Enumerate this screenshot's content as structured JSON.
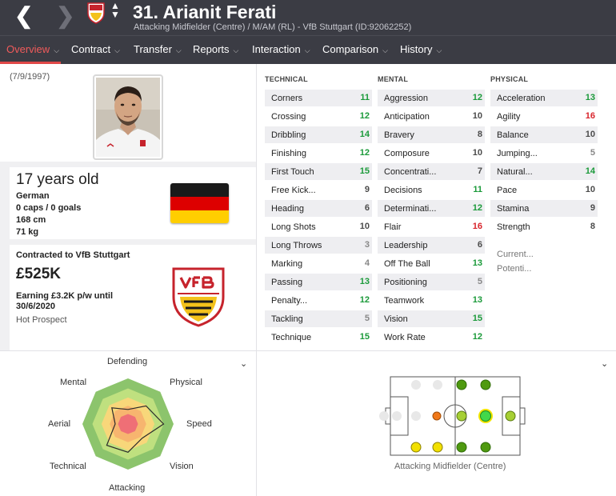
{
  "header": {
    "player_name": "31. Arianit Ferati",
    "player_subtitle": "Attacking Midfielder (Centre) / M/AM (RL) - VfB Stuttgart (ID:92062252)",
    "back_icon": "chevron-left-icon",
    "forward_icon": "chevron-right-icon"
  },
  "tabs": [
    {
      "label": "Overview",
      "active": true
    },
    {
      "label": "Contract"
    },
    {
      "label": "Transfer"
    },
    {
      "label": "Reports"
    },
    {
      "label": "Interaction"
    },
    {
      "label": "Comparison"
    },
    {
      "label": "History"
    }
  ],
  "profile": {
    "dob": "(7/9/1997)",
    "age": "17 years old",
    "nationality": "German",
    "caps": "0 caps / 0 goals",
    "height": "168 cm",
    "weight": "71 kg",
    "contract_title": "Contracted to VfB Stuttgart",
    "value": "£525K",
    "earning": "Earning £3.2K p/w until 30/6/2020",
    "status": "Hot Prospect",
    "flag_colors": [
      "#000000",
      "#dd0000",
      "#ffce00"
    ]
  },
  "attributes": {
    "technical_header": "TECHNICAL",
    "mental_header": "MENTAL",
    "physical_header": "PHYSICAL",
    "technical": [
      {
        "name": "Corners",
        "value": "11"
      },
      {
        "name": "Crossing",
        "value": "12"
      },
      {
        "name": "Dribbling",
        "value": "14"
      },
      {
        "name": "Finishing",
        "value": "12"
      },
      {
        "name": "First Touch",
        "value": "15"
      },
      {
        "name": "Free Kick...",
        "value": "9"
      },
      {
        "name": "Heading",
        "value": "6"
      },
      {
        "name": "Long Shots",
        "value": "10"
      },
      {
        "name": "Long Throws",
        "value": "3"
      },
      {
        "name": "Marking",
        "value": "4"
      },
      {
        "name": "Passing",
        "value": "13"
      },
      {
        "name": "Penalty...",
        "value": "12"
      },
      {
        "name": "Tackling",
        "value": "5"
      },
      {
        "name": "Technique",
        "value": "15"
      }
    ],
    "mental": [
      {
        "name": "Aggression",
        "value": "12"
      },
      {
        "name": "Anticipation",
        "value": "10"
      },
      {
        "name": "Bravery",
        "value": "8"
      },
      {
        "name": "Composure",
        "value": "10"
      },
      {
        "name": "Concentrati...",
        "value": "7"
      },
      {
        "name": "Decisions",
        "value": "11"
      },
      {
        "name": "Determinati...",
        "value": "12"
      },
      {
        "name": "Flair",
        "value": "16"
      },
      {
        "name": "Leadership",
        "value": "6"
      },
      {
        "name": "Off The Ball",
        "value": "13"
      },
      {
        "name": "Positioning",
        "value": "5"
      },
      {
        "name": "Teamwork",
        "value": "13"
      },
      {
        "name": "Vision",
        "value": "15"
      },
      {
        "name": "Work Rate",
        "value": "12"
      }
    ],
    "physical": [
      {
        "name": "Acceleration",
        "value": "13"
      },
      {
        "name": "Agility",
        "value": "16"
      },
      {
        "name": "Balance",
        "value": "10"
      },
      {
        "name": "Jumping...",
        "value": "5"
      },
      {
        "name": "Natural...",
        "value": "14"
      },
      {
        "name": "Pace",
        "value": "10"
      },
      {
        "name": "Stamina",
        "value": "9"
      },
      {
        "name": "Strength",
        "value": "8"
      }
    ],
    "current_label": "Current...",
    "potential_label": "Potenti..."
  },
  "radar": {
    "labels": [
      "Defending",
      "Physical",
      "Speed",
      "Vision",
      "Attacking",
      "Technical",
      "Aerial",
      "Mental"
    ],
    "levels": [
      0.32,
      0.56,
      0.78,
      0.44,
      0.62,
      0.66,
      0.28,
      0.5
    ]
  },
  "positions": {
    "label": "Attacking Midfielder (Centre)"
  },
  "colors": {
    "accent": "#e04848",
    "header_bg": "#3b3c44",
    "green": "#1b9a3a",
    "red": "#d8242b"
  }
}
